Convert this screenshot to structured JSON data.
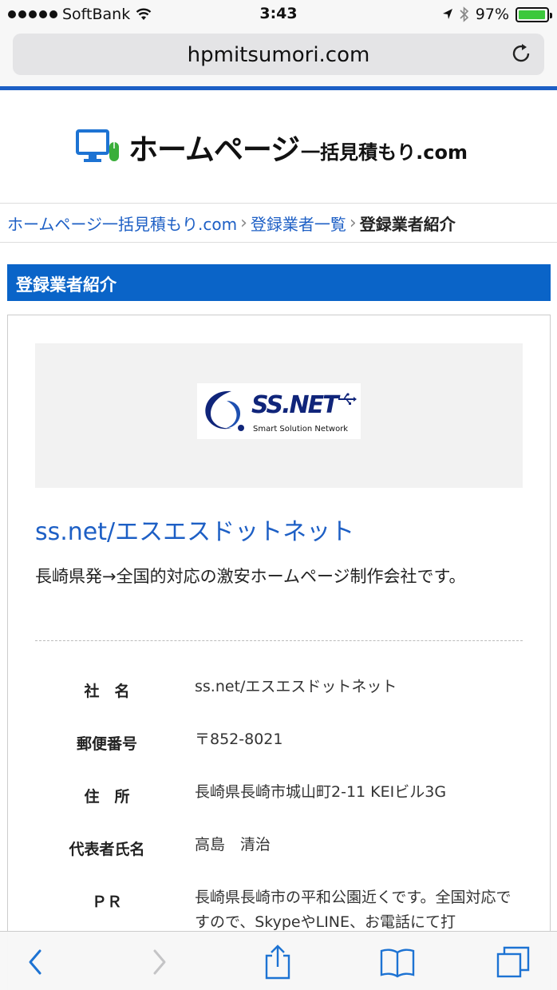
{
  "status": {
    "carrier": "SoftBank",
    "time": "3:43",
    "battery": "97%",
    "battery_level": 0.97
  },
  "browser": {
    "url": "hpmitsumori.com"
  },
  "site": {
    "logo_main": "ホームページ",
    "logo_sub": "一括見積もり.com"
  },
  "breadcrumb": {
    "home": "ホームページ一括見積もり.com",
    "list": "登録業者一覧",
    "current": "登録業者紹介"
  },
  "heading": "登録業者紹介",
  "company": {
    "logo_brand": "SS.NET",
    "logo_tagline": "Smart Solution Network",
    "title": "ss.net/エスエスドットネット",
    "description": "長崎県発→全国的対応の激安ホームページ制作会社です。",
    "info": [
      {
        "label": "社　名",
        "value": "ss.net/エスエスドットネット"
      },
      {
        "label": "郵便番号",
        "value": "〒852-8021"
      },
      {
        "label": "住　所",
        "value": "長崎県長崎市城山町2-11 KEIビル3G"
      },
      {
        "label": "代表者氏名",
        "value": "高島　清治"
      },
      {
        "label": "ＰＲ",
        "value": "長崎県長崎市の平和公園近くです。全国対応ですので、SkypeやLINE、お電話にて打"
      }
    ]
  },
  "colors": {
    "accent": "#0a64c8",
    "link": "#1d5fc5",
    "battery": "#3cc83c"
  },
  "icons": [
    "wifi-icon",
    "location-arrow-icon",
    "bluetooth-icon",
    "battery-icon",
    "reload-icon",
    "monitor-mouse-icon",
    "chevron-right-icon",
    "back-icon",
    "forward-icon",
    "share-icon",
    "bookmarks-icon",
    "tabs-icon"
  ]
}
